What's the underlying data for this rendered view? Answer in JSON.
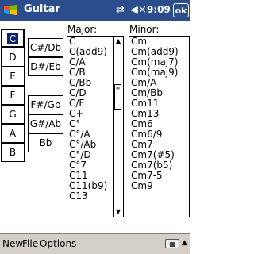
{
  "titlebar": {
    "title": "Guitar",
    "time": "9:09",
    "ok_label": "ok",
    "icons": [
      "windows-start-icon",
      "connectivity-icon",
      "volume-muted-icon"
    ]
  },
  "natural_notes": [
    "C",
    "D",
    "E",
    "F",
    "G",
    "A",
    "B"
  ],
  "selected_note": "C",
  "sharp_notes": [
    "C#/Db",
    "D#/Eb",
    "F#/Gb",
    "G#/Ab",
    "Bb"
  ],
  "major": {
    "header": "Major:",
    "items": [
      "C",
      "C(add9)",
      "C/A",
      "C/B",
      "C/Bb",
      "C/D",
      "C/F",
      "C+",
      "C°",
      "C°/A",
      "C°/Ab",
      "C°/D",
      "C°7",
      "C11",
      "C11(b9)",
      "C13"
    ]
  },
  "minor": {
    "header": "Minor:",
    "items": [
      "Cm",
      "Cm(add9)",
      "Cm(maj7)",
      "Cm(maj9)",
      "Cm/A",
      "Cm/Bb",
      "Cm11",
      "Cm13",
      "Cm6",
      "Cm6/9",
      "Cm7",
      "Cm7(#5)",
      "Cm7(b5)",
      "Cm7-5",
      "Cm9"
    ]
  },
  "menubar": {
    "items": [
      "New",
      "File",
      "Options"
    ]
  }
}
